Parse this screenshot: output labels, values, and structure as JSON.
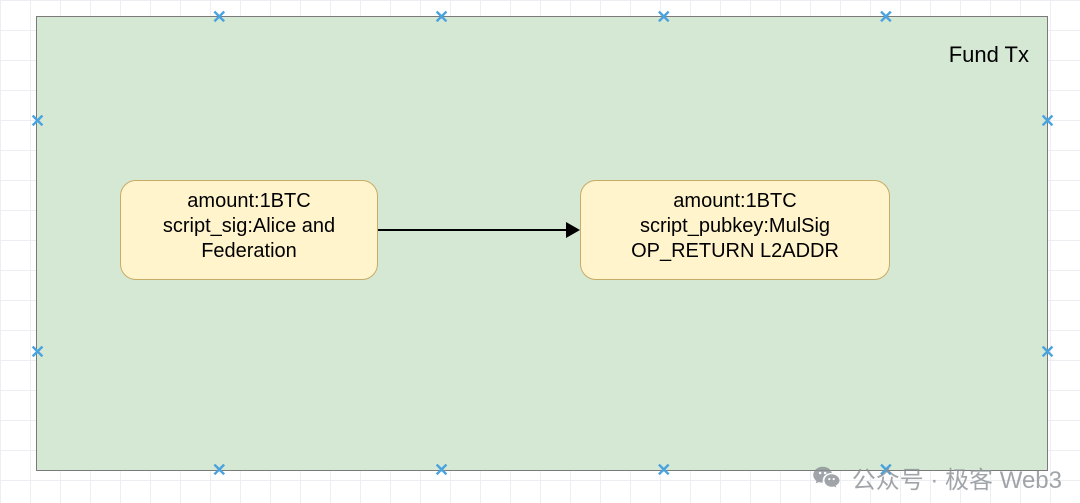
{
  "diagram": {
    "container": {
      "title": "Fund Tx",
      "fill": "#d5e8d4",
      "stroke": "#7a7a7a",
      "selected": true
    },
    "nodes": {
      "input": {
        "line1": "amount:1BTC",
        "line2": "script_sig:Alice and",
        "line3": "Federation",
        "fill": "#fff4cc",
        "stroke": "#c8ab66"
      },
      "output": {
        "line1": "amount:1BTC",
        "line2": "script_pubkey:MulSig",
        "line3": "OP_RETURN L2ADDR",
        "fill": "#fff4cc",
        "stroke": "#c8ab66"
      }
    },
    "arrow": {
      "from": "input",
      "to": "output",
      "color": "#000000"
    }
  },
  "watermark": {
    "text": "公众号 · 极客 Web3"
  }
}
